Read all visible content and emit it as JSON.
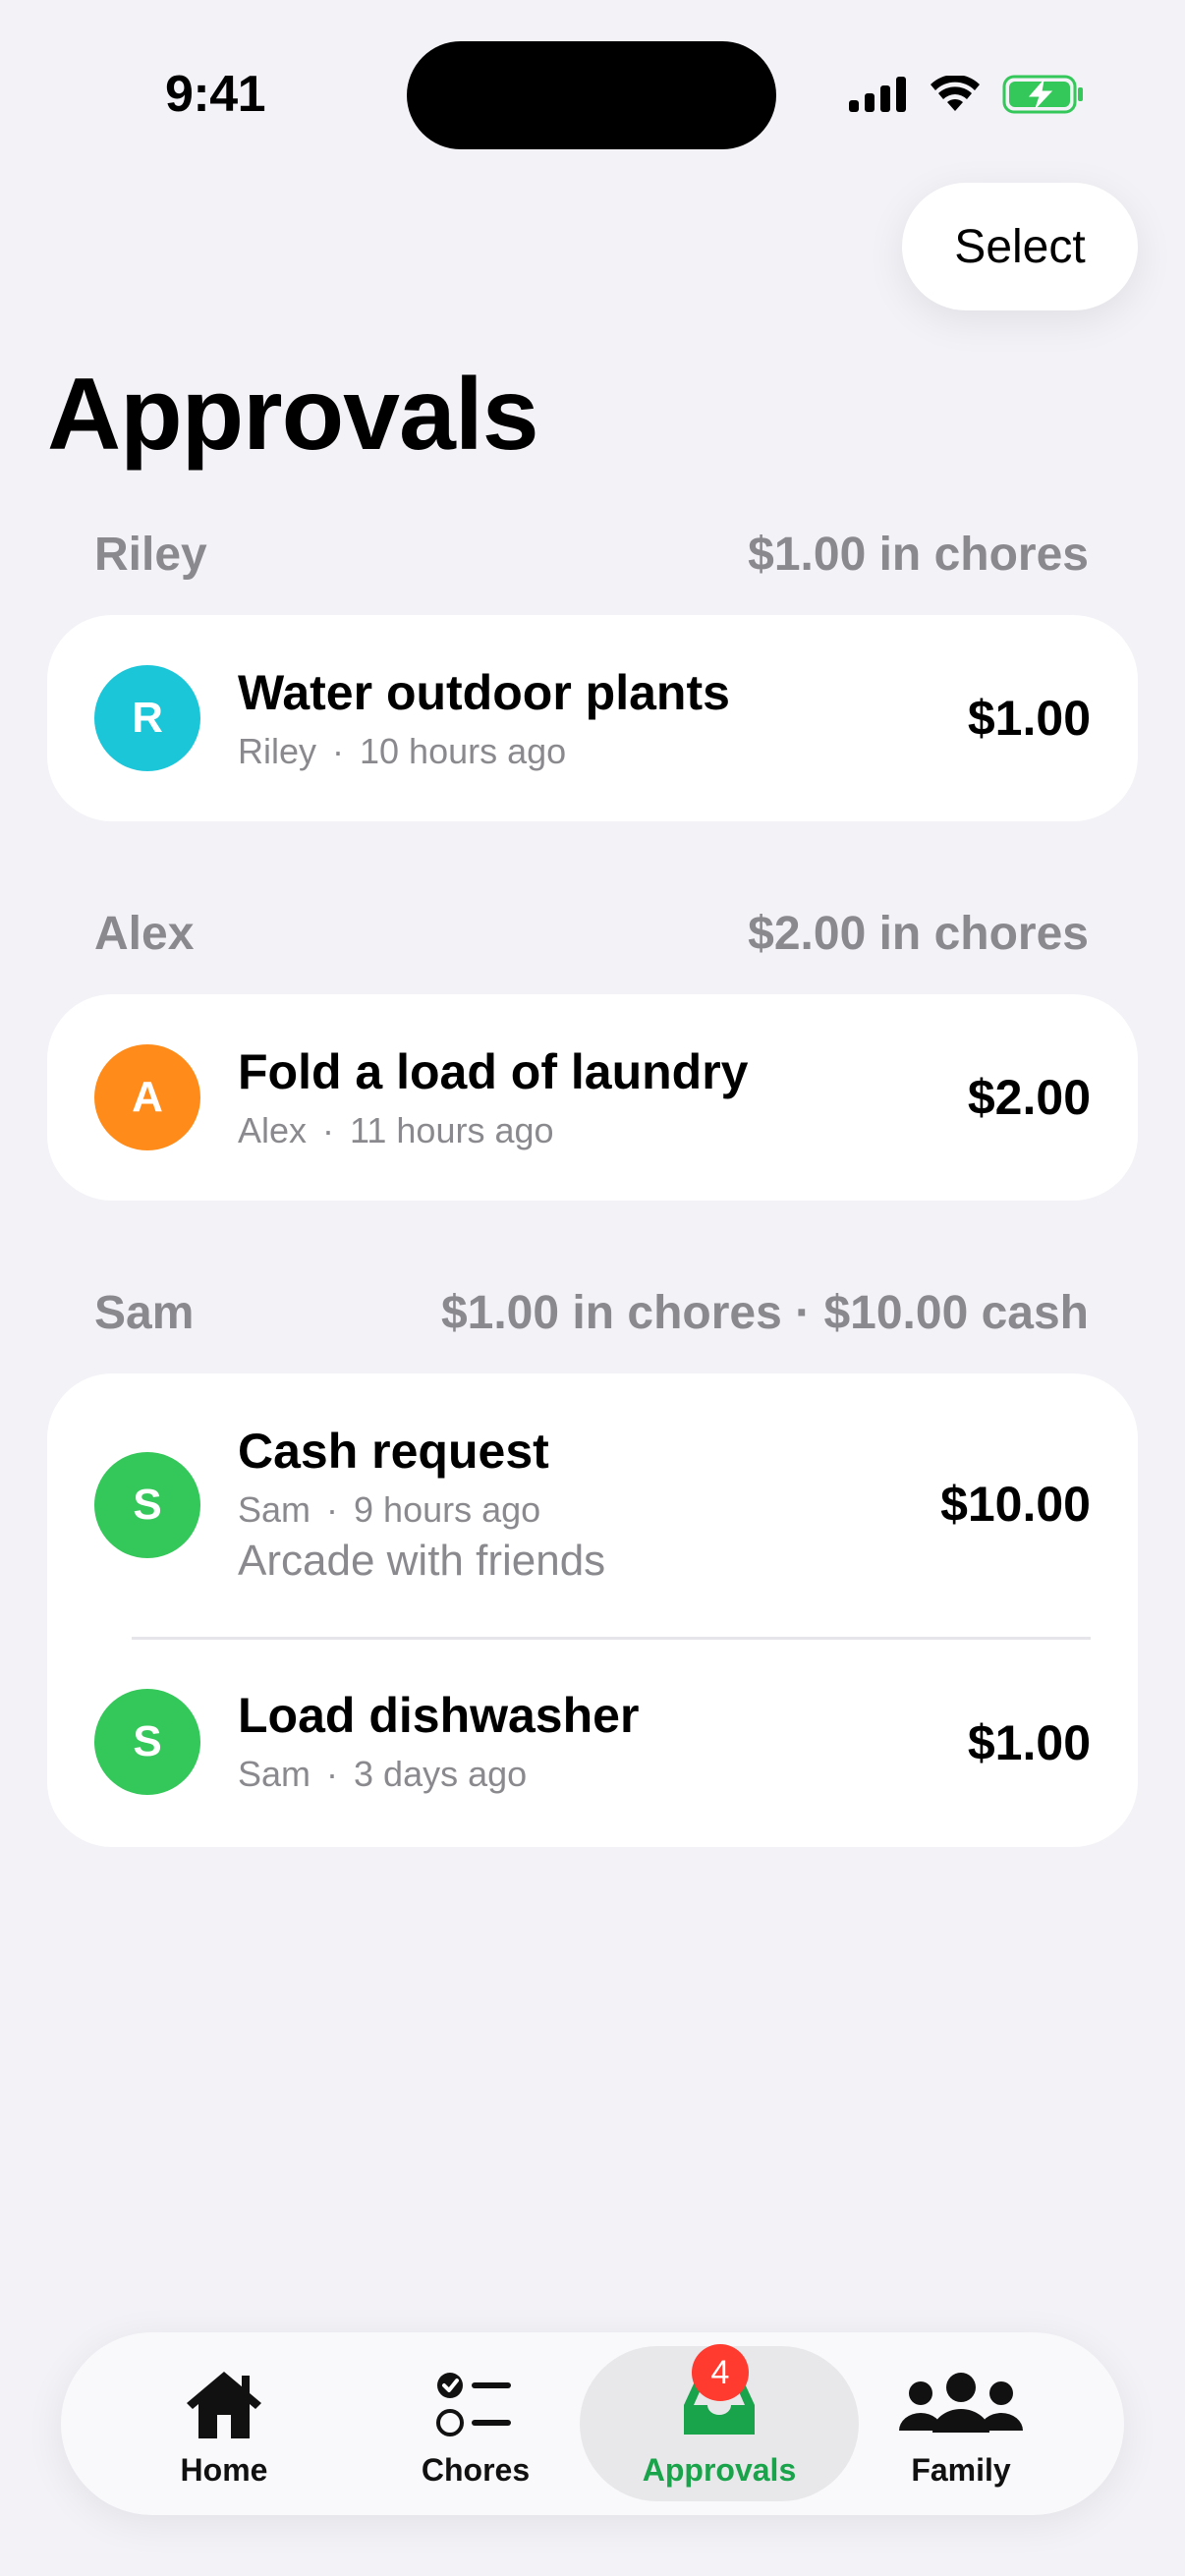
{
  "status_bar": {
    "time": "9:41"
  },
  "header": {
    "select_label": "Select",
    "title": "Approvals"
  },
  "colors": {
    "accent": "#19A34A",
    "badge": "#FF3B30",
    "riley": "#1CC6D9",
    "alex": "#FF8C1A",
    "sam": "#34C759"
  },
  "sections": [
    {
      "name": "Riley",
      "summary": "$1.00 in chores",
      "items": [
        {
          "avatar": "R",
          "title": "Water outdoor plants",
          "person": "Riley",
          "time": "10 hours ago",
          "amount": "$1.00"
        }
      ]
    },
    {
      "name": "Alex",
      "summary": "$2.00 in chores",
      "items": [
        {
          "avatar": "A",
          "title": "Fold a load of laundry",
          "person": "Alex",
          "time": "11 hours ago",
          "amount": "$2.00"
        }
      ]
    },
    {
      "name": "Sam",
      "summary": "$1.00 in chores · $10.00 cash",
      "items": [
        {
          "avatar": "S",
          "title": "Cash request",
          "person": "Sam",
          "time": "9 hours ago",
          "note": "Arcade with friends",
          "amount": "$10.00"
        },
        {
          "avatar": "S",
          "title": "Load dishwasher",
          "person": "Sam",
          "time": "3 days ago",
          "amount": "$1.00"
        }
      ]
    }
  ],
  "tab_bar": {
    "tabs": [
      {
        "label": "Home",
        "icon": "house-icon"
      },
      {
        "label": "Chores",
        "icon": "checklist-icon"
      },
      {
        "label": "Approvals",
        "icon": "tray-icon",
        "active": true,
        "badge": "4"
      },
      {
        "label": "Family",
        "icon": "people-icon"
      }
    ]
  }
}
